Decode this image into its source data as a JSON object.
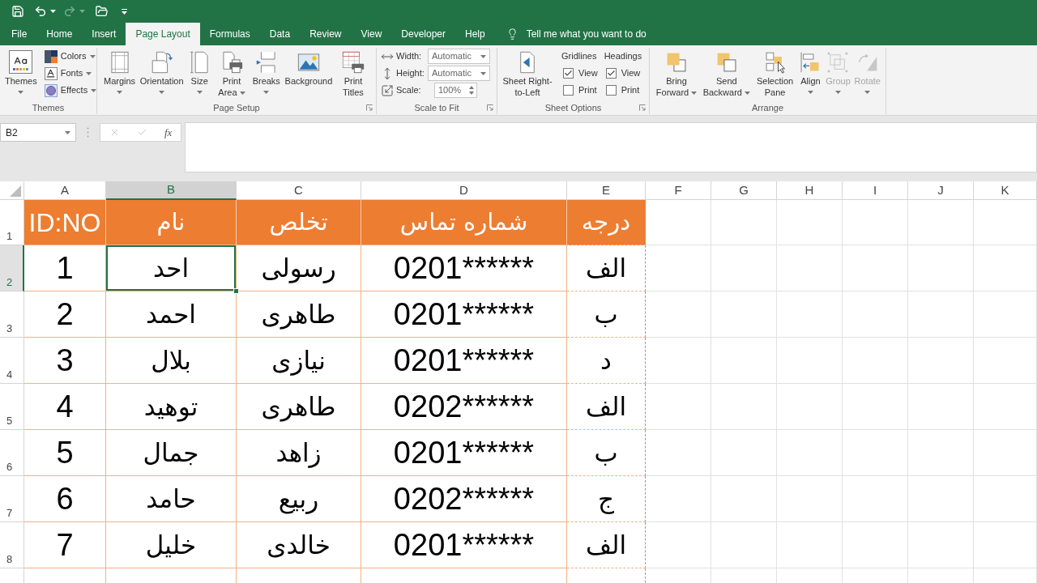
{
  "quick_access": {
    "undo": {
      "disabled": false
    },
    "redo": {
      "disabled": true
    }
  },
  "tabs": [
    {
      "label": "File",
      "selected": false
    },
    {
      "label": "Home",
      "selected": false
    },
    {
      "label": "Insert",
      "selected": false
    },
    {
      "label": "Page Layout",
      "selected": true
    },
    {
      "label": "Formulas",
      "selected": false
    },
    {
      "label": "Data",
      "selected": false
    },
    {
      "label": "Review",
      "selected": false
    },
    {
      "label": "View",
      "selected": false
    },
    {
      "label": "Developer",
      "selected": false
    },
    {
      "label": "Help",
      "selected": false
    }
  ],
  "tell_me": {
    "placeholder": "Tell me what you want to do"
  },
  "ribbon": {
    "groups": [
      {
        "title": "Themes",
        "launcher": false,
        "items": [
          {
            "kind": "large",
            "label": "Themes",
            "dropdown": true,
            "disabled": false
          },
          {
            "kind": "small",
            "label": "Colors",
            "dropdown": true,
            "disabled": false
          },
          {
            "kind": "small",
            "label": "Fonts",
            "dropdown": true,
            "disabled": false
          },
          {
            "kind": "small",
            "label": "Effects",
            "dropdown": true,
            "disabled": false
          }
        ]
      },
      {
        "title": "Page Setup",
        "launcher": true,
        "items": [
          {
            "kind": "large",
            "label": "Margins",
            "dropdown": true,
            "disabled": false
          },
          {
            "kind": "large",
            "label": "Orientation",
            "dropdown": true,
            "disabled": false
          },
          {
            "kind": "large",
            "label": "Size",
            "dropdown": true,
            "disabled": false
          },
          {
            "kind": "large",
            "label": "Print Area",
            "dropdown": true,
            "disabled": false
          },
          {
            "kind": "large",
            "label": "Breaks",
            "dropdown": true,
            "disabled": false
          },
          {
            "kind": "large",
            "label": "Background",
            "dropdown": false,
            "disabled": false
          },
          {
            "kind": "large",
            "label": "Print Titles",
            "dropdown": false,
            "disabled": false
          }
        ]
      },
      {
        "title": "Scale to Fit",
        "launcher": true,
        "items": [
          {
            "kind": "dropdown_field",
            "label": "Width:",
            "value": "Automatic",
            "disabled": false
          },
          {
            "kind": "dropdown_field",
            "label": "Height:",
            "value": "Automatic",
            "disabled": false
          },
          {
            "kind": "spin_field",
            "label": "Scale:",
            "value": "100%",
            "disabled": false
          }
        ]
      },
      {
        "title": "Sheet Options",
        "launcher": true,
        "items": [
          {
            "kind": "large",
            "label": "Sheet Right-to-Left",
            "dropdown": false,
            "disabled": false
          },
          {
            "kind": "checklist",
            "label": "Gridlines",
            "disabled": false,
            "options": [
              {
                "label": "View",
                "checked": true
              },
              {
                "label": "Print",
                "checked": false
              }
            ]
          },
          {
            "kind": "checklist",
            "label": "Headings",
            "disabled": false,
            "options": [
              {
                "label": "View",
                "checked": true
              },
              {
                "label": "Print",
                "checked": false
              }
            ]
          }
        ]
      },
      {
        "title": "Arrange",
        "launcher": false,
        "items": [
          {
            "kind": "large",
            "label": "Bring Forward",
            "dropdown": true,
            "disabled": false
          },
          {
            "kind": "large",
            "label": "Send Backward",
            "dropdown": true,
            "disabled": false
          },
          {
            "kind": "large",
            "label": "Selection Pane",
            "dropdown": false,
            "disabled": false
          },
          {
            "kind": "large",
            "label": "Align",
            "dropdown": true,
            "disabled": false
          },
          {
            "kind": "large",
            "label": "Group",
            "dropdown": true,
            "disabled": true
          },
          {
            "kind": "large",
            "label": "Rotate",
            "dropdown": true,
            "disabled": true
          }
        ]
      }
    ]
  },
  "formula_bar": {
    "name_box": "B2",
    "function_button": "fx"
  },
  "sheet": {
    "columns": [
      {
        "label": "A",
        "selected": false
      },
      {
        "label": "B",
        "selected": true
      },
      {
        "label": "C",
        "selected": false
      },
      {
        "label": "D",
        "selected": false
      },
      {
        "label": "E",
        "selected": false
      },
      {
        "label": "F",
        "selected": false
      },
      {
        "label": "G",
        "selected": false
      },
      {
        "label": "H",
        "selected": false
      },
      {
        "label": "I",
        "selected": false
      },
      {
        "label": "J",
        "selected": false
      },
      {
        "label": "K",
        "selected": false
      }
    ],
    "rows": [
      {
        "number": "1",
        "selected": false,
        "kind": "header",
        "cells": [
          {
            "text": "ID:NO",
            "selected": false
          },
          {
            "text": "نام",
            "selected": false
          },
          {
            "text": "تخلص",
            "selected": false
          },
          {
            "text": "شماره تماس",
            "selected": false
          },
          {
            "text": "درجه",
            "selected": false
          }
        ]
      },
      {
        "number": "2",
        "selected": true,
        "kind": "data",
        "cells": [
          {
            "text": "1",
            "selected": false
          },
          {
            "text": "احد",
            "selected": true
          },
          {
            "text": "رسولی",
            "selected": false
          },
          {
            "text": "0201******",
            "selected": false
          },
          {
            "text": "الف",
            "selected": false
          }
        ]
      },
      {
        "number": "3",
        "selected": false,
        "kind": "data",
        "cells": [
          {
            "text": "2",
            "selected": false
          },
          {
            "text": "احمد",
            "selected": false
          },
          {
            "text": "طاهری",
            "selected": false
          },
          {
            "text": "0201******",
            "selected": false
          },
          {
            "text": "ب",
            "selected": false
          }
        ]
      },
      {
        "number": "4",
        "selected": false,
        "kind": "data",
        "cells": [
          {
            "text": "3",
            "selected": false
          },
          {
            "text": "بلال",
            "selected": false
          },
          {
            "text": "نیازی",
            "selected": false
          },
          {
            "text": "0201******",
            "selected": false
          },
          {
            "text": "د",
            "selected": false
          }
        ]
      },
      {
        "number": "5",
        "selected": false,
        "kind": "data",
        "cells": [
          {
            "text": "4",
            "selected": false
          },
          {
            "text": "توهید",
            "selected": false
          },
          {
            "text": "طاهری",
            "selected": false
          },
          {
            "text": "0202******",
            "selected": false
          },
          {
            "text": "الف",
            "selected": false
          }
        ]
      },
      {
        "number": "6",
        "selected": false,
        "kind": "data",
        "cells": [
          {
            "text": "5",
            "selected": false
          },
          {
            "text": "جمال",
            "selected": false
          },
          {
            "text": "زاهد",
            "selected": false
          },
          {
            "text": "0201******",
            "selected": false
          },
          {
            "text": "ب",
            "selected": false
          }
        ]
      },
      {
        "number": "7",
        "selected": false,
        "kind": "data",
        "cells": [
          {
            "text": "6",
            "selected": false
          },
          {
            "text": "حامد",
            "selected": false
          },
          {
            "text": "ربیع",
            "selected": false
          },
          {
            "text": "0202******",
            "selected": false
          },
          {
            "text": "ج",
            "selected": false
          }
        ]
      },
      {
        "number": "8",
        "selected": false,
        "kind": "data",
        "cells": [
          {
            "text": "7",
            "selected": false
          },
          {
            "text": "خلیل",
            "selected": false
          },
          {
            "text": "خالدی",
            "selected": false
          },
          {
            "text": "0201******",
            "selected": false
          },
          {
            "text": "الف",
            "selected": false
          }
        ]
      }
    ]
  }
}
